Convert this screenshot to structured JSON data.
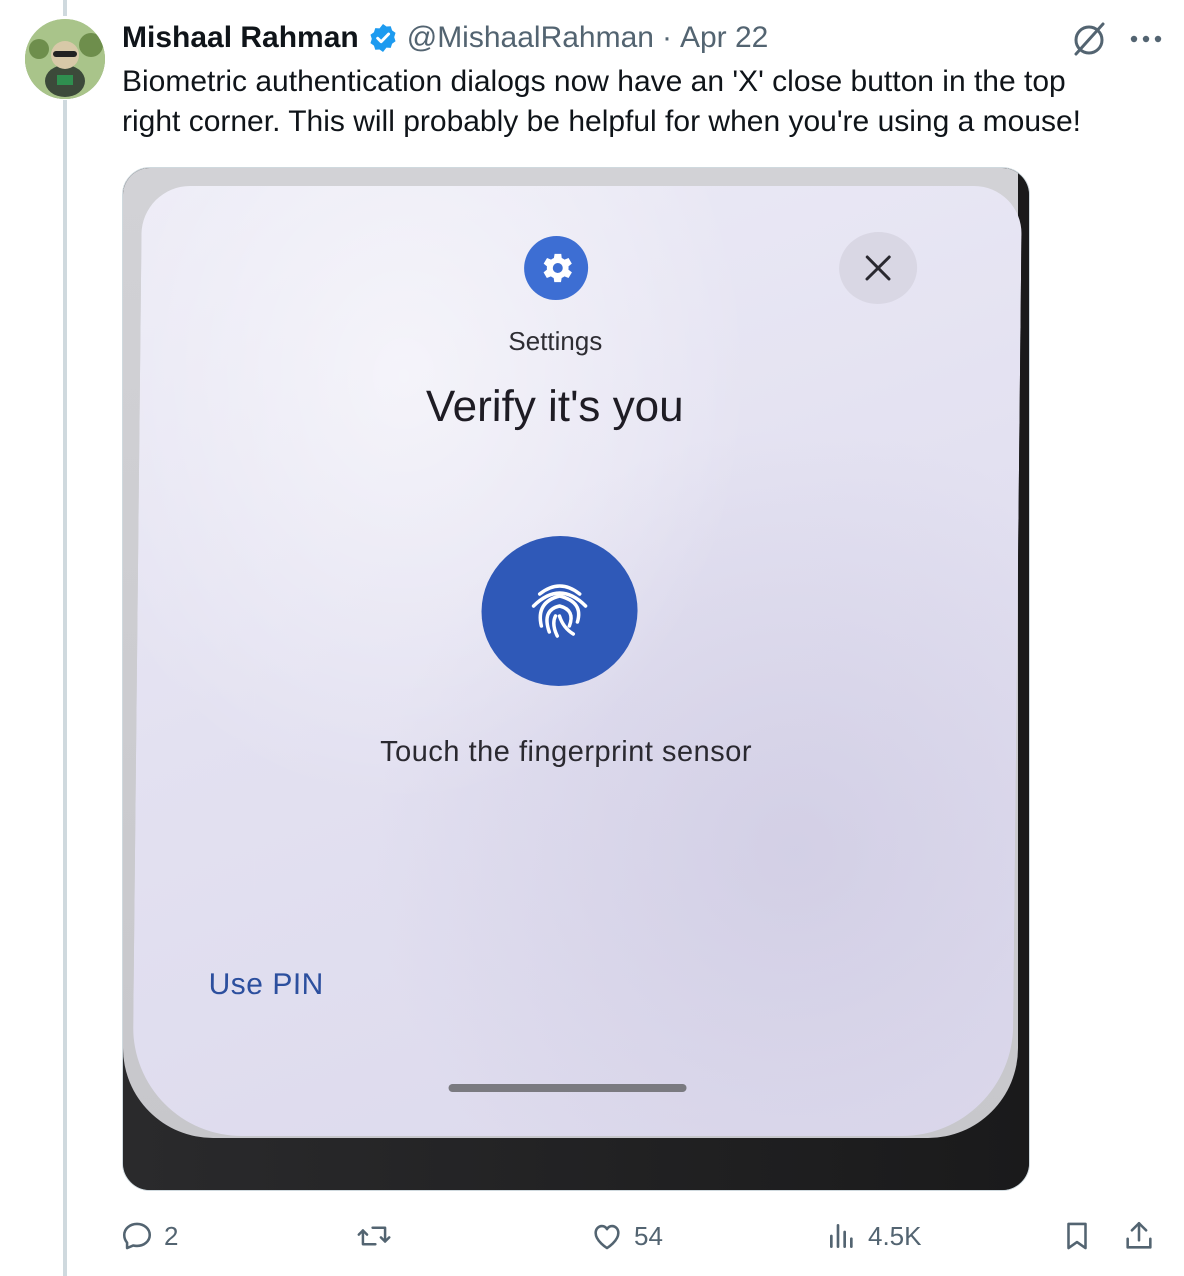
{
  "tweet": {
    "author_name": "Mishaal Rahman",
    "handle": "@MishaalRahman",
    "separator": "·",
    "date": "Apr 22",
    "text": "Biometric authentication dialogs now have an 'X' close button in the top right corner. This will probably be helpful for when you're using a mouse!"
  },
  "media": {
    "app_name": "Settings",
    "dialog_title": "Verify it's you",
    "instruction": "Touch the fingerprint sensor",
    "alt_action": "Use PIN",
    "app_icon": "gear-icon",
    "center_icon": "fingerprint-icon",
    "close_icon": "close-icon"
  },
  "actions": {
    "replies": "2",
    "likes": "54",
    "views": "4.5K"
  },
  "colors": {
    "accent": "#1d9bf0",
    "muted": "#536471",
    "dialog_blue": "#2f59b8"
  }
}
